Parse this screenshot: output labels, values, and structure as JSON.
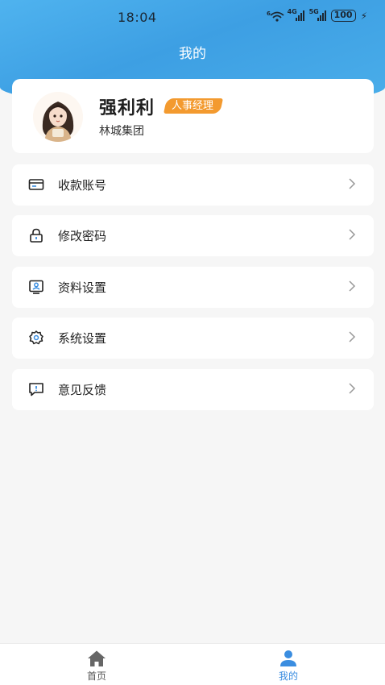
{
  "status_bar": {
    "time": "18:04",
    "wifi_label": "6",
    "signal1_label": "4G",
    "signal2_label": "5G",
    "battery": "100"
  },
  "header": {
    "title": "我的"
  },
  "profile": {
    "name": "强利利",
    "role": "人事经理",
    "company": "林城集团"
  },
  "menu": [
    {
      "label": "收款账号",
      "icon": "card-icon"
    },
    {
      "label": "修改密码",
      "icon": "lock-icon"
    },
    {
      "label": "资料设置",
      "icon": "profile-icon"
    },
    {
      "label": "系统设置",
      "icon": "gear-icon"
    },
    {
      "label": "意见反馈",
      "icon": "feedback-icon"
    }
  ],
  "bottom_nav": {
    "tabs": [
      {
        "label": "首页",
        "icon": "home-icon",
        "active": false
      },
      {
        "label": "我的",
        "icon": "user-icon",
        "active": true
      }
    ]
  },
  "colors": {
    "header_blue": "#3d9fe3",
    "badge_orange": "#f39a2f",
    "active_tab": "#3a8de0",
    "inactive_tab": "#555555"
  }
}
